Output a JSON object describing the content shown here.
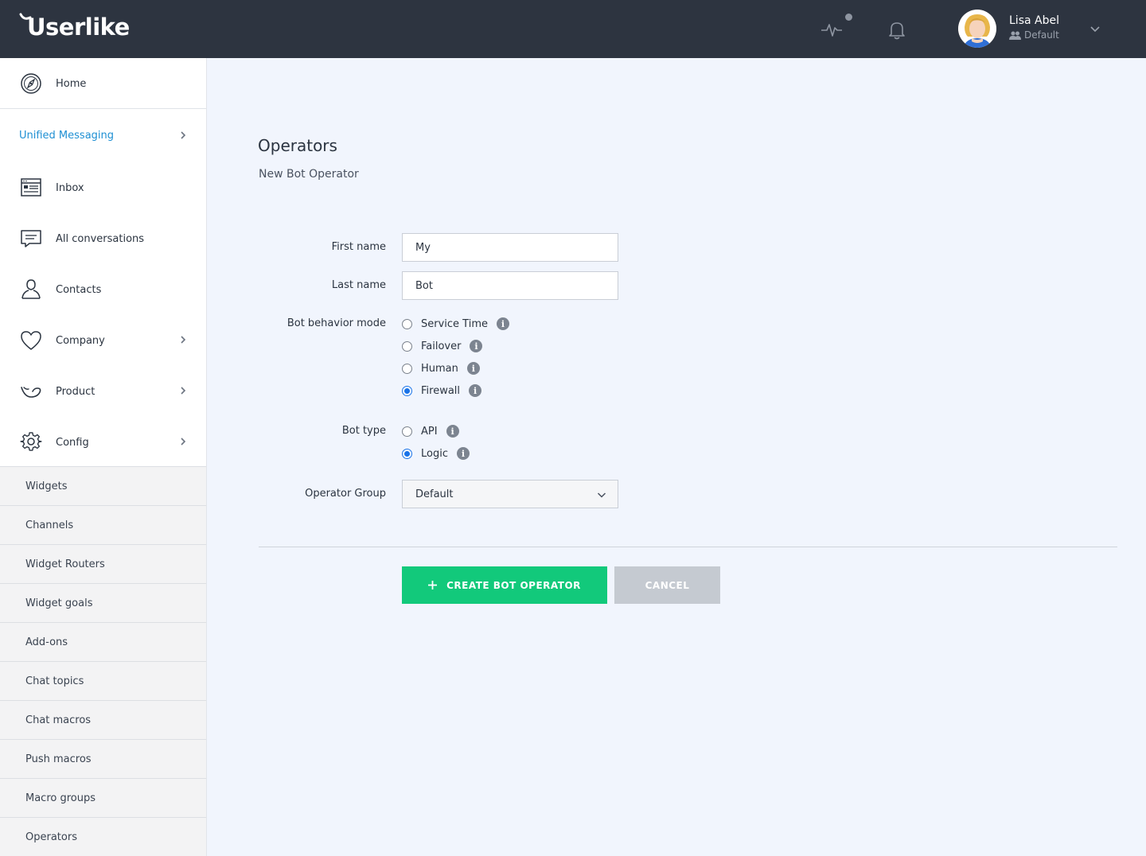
{
  "header": {
    "logo": "Userlike",
    "user": {
      "name": "Lisa Abel",
      "group": "Default"
    },
    "icons": [
      "activity-pulse-icon",
      "bell-icon",
      "chevron-down-icon"
    ]
  },
  "sidebar": {
    "home": "Home",
    "section": "Unified Messaging",
    "items": [
      {
        "label": "Inbox",
        "icon": "inbox-icon"
      },
      {
        "label": "All conversations",
        "icon": "conversations-icon"
      },
      {
        "label": "Contacts",
        "icon": "contacts-icon"
      },
      {
        "label": "Company",
        "icon": "heart-icon"
      },
      {
        "label": "Product",
        "icon": "product-icon"
      },
      {
        "label": "Config",
        "icon": "gear-icon"
      }
    ],
    "subitems": [
      "Widgets",
      "Channels",
      "Widget Routers",
      "Widget goals",
      "Add-ons",
      "Chat topics",
      "Chat macros",
      "Push macros",
      "Macro groups",
      "Operators"
    ]
  },
  "main": {
    "title": "Operators",
    "subtitle": "New Bot Operator",
    "first_name": {
      "label": "First name",
      "value": "My"
    },
    "last_name": {
      "label": "Last name",
      "value": "Bot"
    },
    "behavior": {
      "label": "Bot behavior mode",
      "options": [
        "Service Time",
        "Failover",
        "Human",
        "Firewall"
      ],
      "selected": "Firewall"
    },
    "bot_type": {
      "label": "Bot type",
      "options": [
        "API",
        "Logic"
      ],
      "selected": "Logic"
    },
    "group": {
      "label": "Operator Group",
      "value": "Default"
    },
    "create_label": "CREATE BOT OPERATOR",
    "cancel_label": "CANCEL"
  },
  "colors": {
    "topbar": "#2d3440",
    "accent_link": "#1e8fd3",
    "create_button": "#12c97b",
    "cancel_button": "#c5cad1"
  }
}
